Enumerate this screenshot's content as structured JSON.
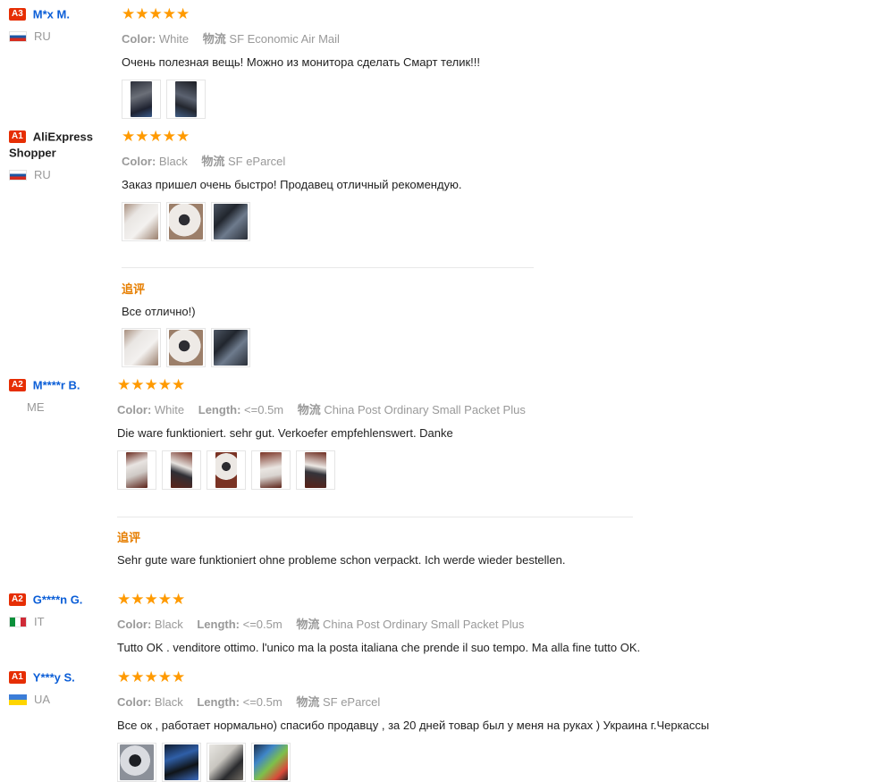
{
  "reviews": [
    {
      "level": "A3",
      "name": "M*x M.",
      "country": "RU",
      "stars": "★★★★★",
      "color_label": "Color:",
      "color_value": "White",
      "shipping_label": "物流",
      "shipping_value": "SF Economic Air Mail",
      "text": "Очень полезная вещь! Можно из монитора сделать Смарт телик!!!"
    },
    {
      "level": "A1",
      "name": "AliExpress Shopper",
      "country": "RU",
      "stars": "★★★★★",
      "color_label": "Color:",
      "color_value": "Black",
      "shipping_label": "物流",
      "shipping_value": "SF eParcel",
      "text": "Заказ пришел очень быстро! Продавец отличный рекомендую.",
      "additional_label": "追评",
      "additional_text": "Все отлично!)"
    },
    {
      "level": "A2",
      "name": "M****r B.",
      "country": "ME",
      "stars": "★★★★★",
      "color_label": "Color:",
      "color_value": "White",
      "length_label": "Length:",
      "length_value": "<=0.5m",
      "shipping_label": "物流",
      "shipping_value": "China Post Ordinary Small Packet Plus",
      "text": "Die ware funktioniert. sehr gut. Verkoefer empfehlenswert. Danke",
      "additional_label": "追评",
      "additional_text": "Sehr gute ware funktioniert ohne probleme schon verpackt. Ich werde wieder bestellen."
    },
    {
      "level": "A2",
      "name": "G****n G.",
      "country": "IT",
      "stars": "★★★★★",
      "color_label": "Color:",
      "color_value": "Black",
      "length_label": "Length:",
      "length_value": "<=0.5m",
      "shipping_label": "物流",
      "shipping_value": "China Post Ordinary Small Packet Plus",
      "text": "Tutto OK . venditore ottimo. l'unico ma la posta italiana che prende il suo tempo. Ma alla fine tutto OK."
    },
    {
      "level": "A1",
      "name": "Y***y S.",
      "country": "UA",
      "stars": "★★★★★",
      "color_label": "Color:",
      "color_value": "Black",
      "length_label": "Length:",
      "length_value": "<=0.5m",
      "shipping_label": "物流",
      "shipping_value": "SF eParcel",
      "text": "Все ок , работает нормально) спасибо продавцу , за 20 дней товар был у меня на руках ) Украина г.Черкассы"
    }
  ],
  "colors": {
    "level_badge": "#e62e04",
    "username": "#0b5ed7",
    "stars": "#ff9a00",
    "additional_label": "#e67e00"
  },
  "icons": {
    "flag_ru": "flag-ru-icon",
    "flag_it": "flag-it-icon",
    "flag_ua": "flag-ua-icon",
    "star": "star-icon"
  }
}
